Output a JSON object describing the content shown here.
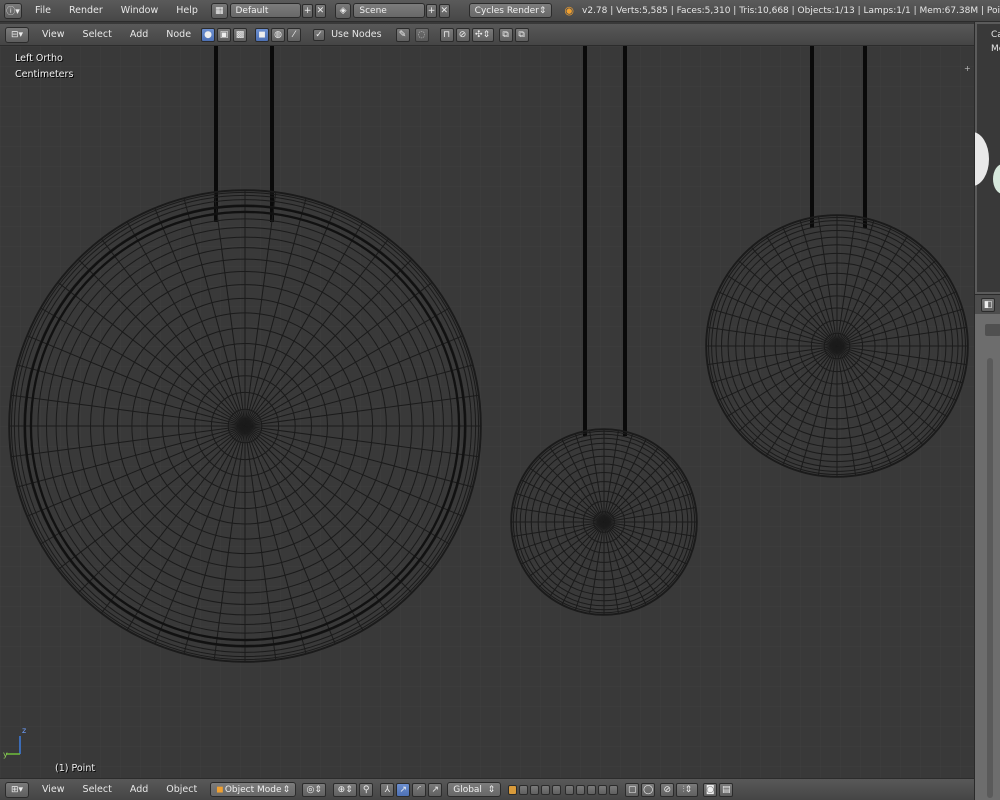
{
  "topbar": {
    "menus": [
      "File",
      "Render",
      "Window",
      "Help"
    ],
    "layout_name": "Default",
    "scene_name": "Scene",
    "engine": "Cycles Render",
    "stats": "v2.78 | Verts:5,585 | Faces:5,310 | Tris:10,668 | Objects:1/13 | Lamps:1/1 | Mem:67.38M | Poi"
  },
  "node_header": {
    "menus": [
      "View",
      "Select",
      "Add",
      "Node"
    ],
    "use_nodes_label": "Use Nodes",
    "use_nodes_checked": true
  },
  "viewport": {
    "view_name": "Left Ortho",
    "units": "Centimeters",
    "object_label": "(1) Point",
    "axis_y": "y",
    "axis_z": "z"
  },
  "right_panel": {
    "label_a": "Ca",
    "label_b": "Me"
  },
  "bottombar": {
    "menus": [
      "View",
      "Select",
      "Add",
      "Object"
    ],
    "mode": "Object Mode",
    "orientation": "Global"
  },
  "icons": {
    "info": "info-icon",
    "layout": "screen-layout-icon",
    "scene": "scene-icon",
    "blender": "blender-logo-icon"
  },
  "colors": {
    "viewport_bg": "#393939",
    "wire": "#1a1a1a",
    "header": "#4e4e4e",
    "accent_blue": "#5680c2"
  }
}
